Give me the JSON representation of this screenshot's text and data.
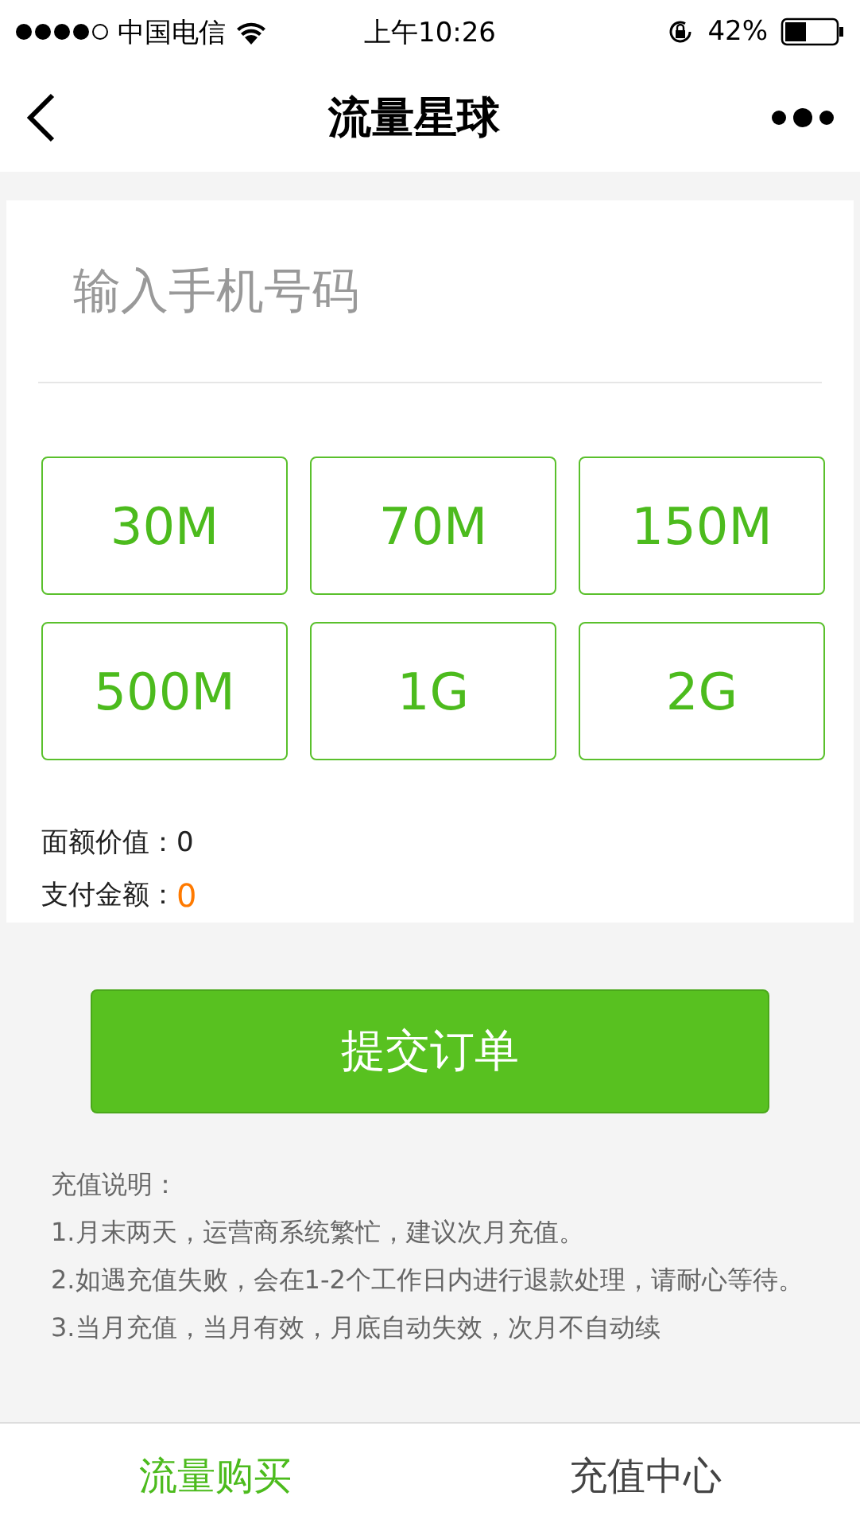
{
  "status_bar": {
    "carrier": "中国电信",
    "time": "上午10:26",
    "battery": "42%"
  },
  "nav": {
    "title": "流量星球"
  },
  "phone_field": {
    "placeholder": "输入手机号码"
  },
  "packages": [
    {
      "label": "30M",
      "selected": false
    },
    {
      "label": "70M",
      "selected": false
    },
    {
      "label": "150M",
      "selected": false
    },
    {
      "label": "500M",
      "selected": false
    },
    {
      "label": "1G",
      "selected": false
    },
    {
      "label": "2G",
      "selected": false
    }
  ],
  "face_value": {
    "label": "面额价值：",
    "value": "0"
  },
  "pay_amount": {
    "label": "支付金额：",
    "value": "0"
  },
  "submit_button": "提交订单",
  "notes": [
    "充值说明：",
    "1.月末两天，运营商系统繁忙，建议次月充值。",
    "2.如遇充值失败，会在1-2个工作日内进行退款处理，请耐心等待。",
    "3.当月充值，当月有效，月底自动失效，次月不自动续"
  ],
  "tab_bar": [
    {
      "label": "流量购买",
      "selected": true
    },
    {
      "label": "充值中心",
      "selected": false
    }
  ]
}
